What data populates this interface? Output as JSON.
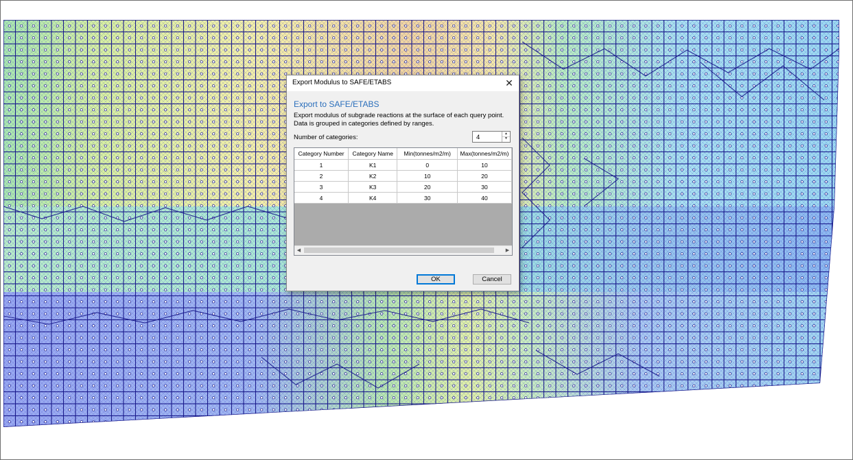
{
  "dialog": {
    "title": "Export Modulus to SAFE/ETABS",
    "close_glyph": "✕",
    "heading": "Export to SAFE/ETABS",
    "description": "Export modulus of subgrade reactions at the surface of each query point. Data is grouped in categories defined by ranges.",
    "categories_label": "Number of categories:",
    "categories_value": "4",
    "table": {
      "columns": [
        "Category Number",
        "Category Name",
        "Min(tonnes/m2/m)",
        "Max(tonnes/m2/m)"
      ],
      "rows": [
        [
          "1",
          "K1",
          "0",
          "10"
        ],
        [
          "2",
          "K2",
          "10",
          "20"
        ],
        [
          "3",
          "K3",
          "20",
          "30"
        ],
        [
          "4",
          "K4",
          "30",
          "40"
        ]
      ]
    },
    "ok_label": "OK",
    "cancel_label": "Cancel"
  },
  "icons": {
    "spin_up": "up-arrow-icon",
    "spin_down": "down-arrow-icon",
    "scroll_left": "left-arrow-icon",
    "scroll_right": "right-arrow-icon"
  },
  "colors": {
    "heading": "#2a6ebb",
    "mesh_lines": "#1a1a8c",
    "contour_low": "#6f8ff0",
    "contour_high": "#f0c890"
  }
}
